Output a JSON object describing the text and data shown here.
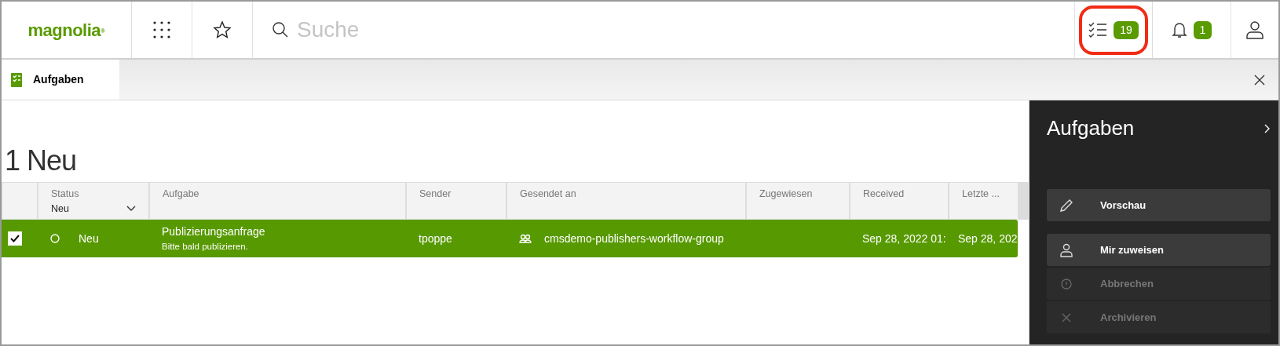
{
  "header": {
    "logo": "magnolia$^{®}$",
    "search": {
      "placeholder": "Suche"
    },
    "tasks": {
      "count": "19",
      "highlighted": true
    },
    "notifications": {
      "count": "1"
    }
  },
  "tabs": [
    {
      "label": "Aufgaben",
      "selected": true
    }
  ],
  "heading": "1 Neu",
  "table": {
    "columns": [
      {
        "label": "Status",
        "filter": "Neu"
      },
      {
        "label": "Aufgabe"
      },
      {
        "label": "Sender"
      },
      {
        "label": "Gesendet an"
      },
      {
        "label": "Zugewiesen"
      },
      {
        "label": "Received"
      },
      {
        "label": "Letzte ..."
      }
    ],
    "rows": [
      {
        "selected": true,
        "status": "Neu",
        "task": "Publizierungsanfrage",
        "message": "Bitte bald publizieren.",
        "sender": "tpoppe",
        "sent_to": "cmsdemo-publishers-workflow-group",
        "received": "Sep 28, 2022 01:",
        "last": "Sep 28, 202"
      }
    ]
  },
  "panel": {
    "title": "Aufgaben",
    "action_groups": [
      [
        {
          "label": "Vorschau",
          "kind": "edit",
          "disabled": false
        }
      ],
      [
        {
          "label": "Mir zuweisen",
          "kind": "assign",
          "disabled": false
        },
        {
          "label": "Abbrechen",
          "kind": "abort",
          "disabled": true
        },
        {
          "label": "Archivieren",
          "kind": "archive",
          "disabled": true
        }
      ]
    ]
  }
}
